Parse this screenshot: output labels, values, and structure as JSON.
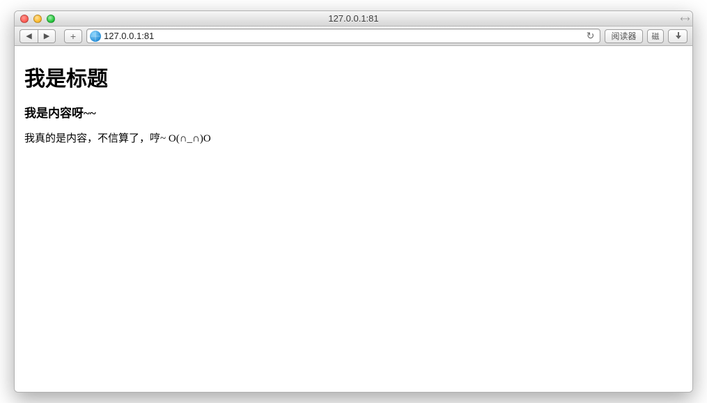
{
  "window": {
    "title": "127.0.0.1:81"
  },
  "toolbar": {
    "url": "127.0.0.1:81",
    "reader_label": "阅读器",
    "han_button": "磁"
  },
  "page": {
    "heading": "我是标题",
    "subheading": "我是内容呀~~",
    "body": "我真的是内容，不信算了，哼~ O(∩_∩)O"
  }
}
